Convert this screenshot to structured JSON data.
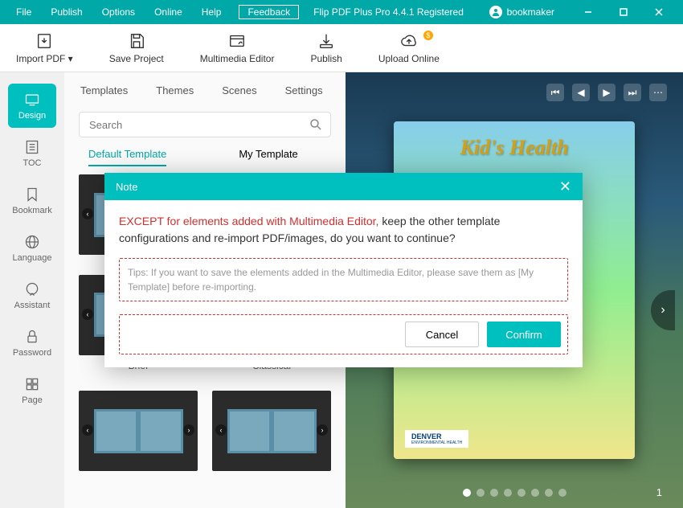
{
  "menu": {
    "file": "File",
    "publish": "Publish",
    "options": "Options",
    "online": "Online",
    "help": "Help",
    "feedback": "Feedback"
  },
  "app": {
    "title": "Flip PDF Plus Pro 4.4.1 Registered",
    "user": "bookmaker"
  },
  "toolbar": {
    "import": "Import PDF",
    "save": "Save Project",
    "multimedia": "Multimedia Editor",
    "publish": "Publish",
    "upload": "Upload Online"
  },
  "sidebar": {
    "design": "Design",
    "toc": "TOC",
    "bookmark": "Bookmark",
    "language": "Language",
    "assistant": "Assistant",
    "password": "Password",
    "page": "Page"
  },
  "tabs": {
    "templates": "Templates",
    "themes": "Themes",
    "scenes": "Scenes",
    "settings": "Settings"
  },
  "search": {
    "placeholder": "Search"
  },
  "subtabs": {
    "default": "Default Template",
    "my": "My Template"
  },
  "tpl": {
    "brief": "Brief",
    "classical": "Classical"
  },
  "book": {
    "title": "Kid's Health",
    "logo": "DENVER",
    "logo_sub": "ENVIRONMENTAL HEALTH"
  },
  "page": {
    "num": "1"
  },
  "modal": {
    "title": "Note",
    "highlight": "EXCEPT for elements added with Multimedia Editor,",
    "rest": " keep the other template configurations and re-import PDF/images, do you want to continue?",
    "tips": "Tips: If you want to save the elements added in the Multimedia Editor, please save them as [My Template] before re-importing.",
    "cancel": "Cancel",
    "confirm": "Confirm"
  }
}
